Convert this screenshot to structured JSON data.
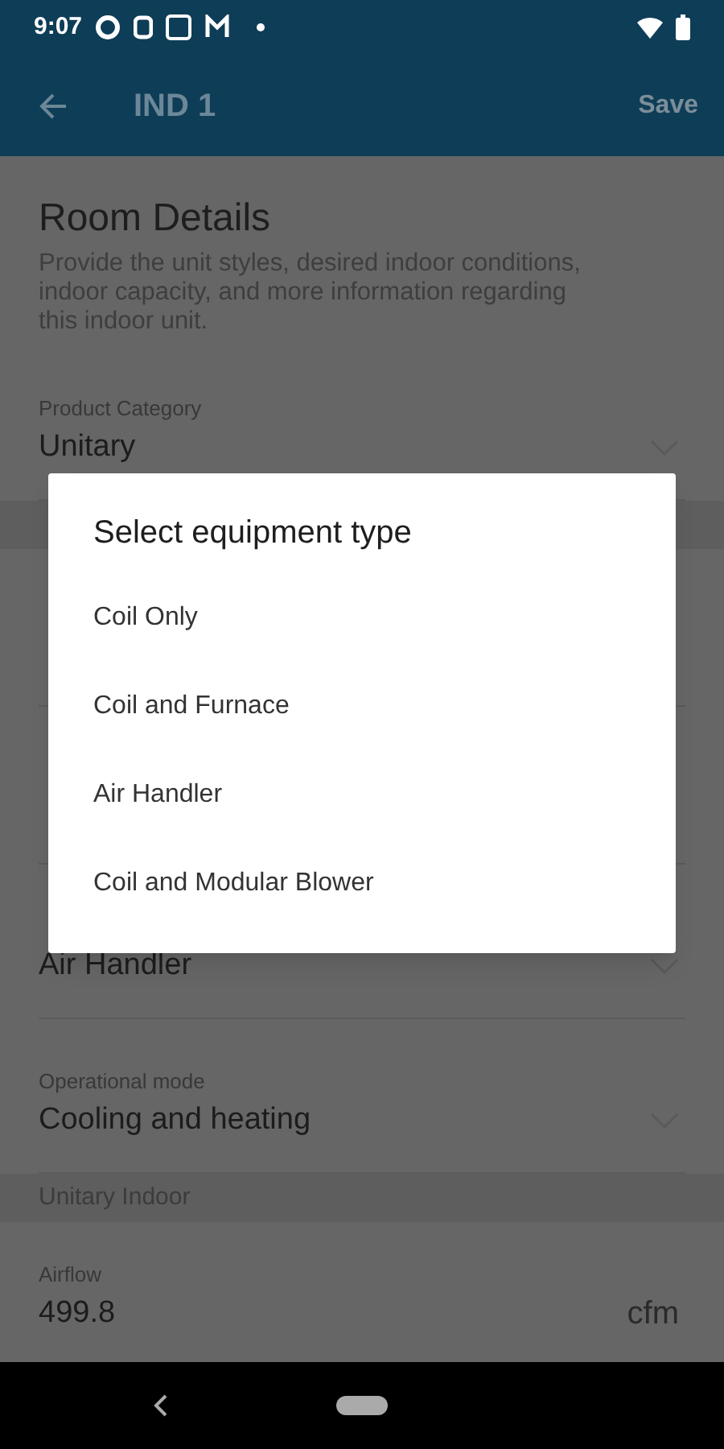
{
  "status_bar": {
    "time": "9:07"
  },
  "app_bar": {
    "title": "IND 1",
    "action": "Save"
  },
  "header": {
    "title": "Room Details",
    "description": "Provide the unit styles, desired indoor conditions, indoor capacity, and more information regarding this indoor unit."
  },
  "fields": [
    {
      "kind": "select",
      "label": "Product Category",
      "value": "Unitary"
    },
    {
      "kind": "section"
    },
    {
      "kind": "blank"
    },
    {
      "kind": "blank"
    },
    {
      "kind": "select",
      "value": "Air Handler"
    },
    {
      "kind": "select",
      "label": "Operational mode",
      "value": "Cooling and heating"
    },
    {
      "kind": "section",
      "label": "Unitary Indoor"
    },
    {
      "kind": "number",
      "label": "Airflow",
      "value": "499.8",
      "unit": "cfm"
    }
  ],
  "dialog": {
    "title": "Select equipment type",
    "options": [
      "Coil Only",
      "Coil and Furnace",
      "Air Handler",
      "Coil and Modular Blower"
    ]
  }
}
